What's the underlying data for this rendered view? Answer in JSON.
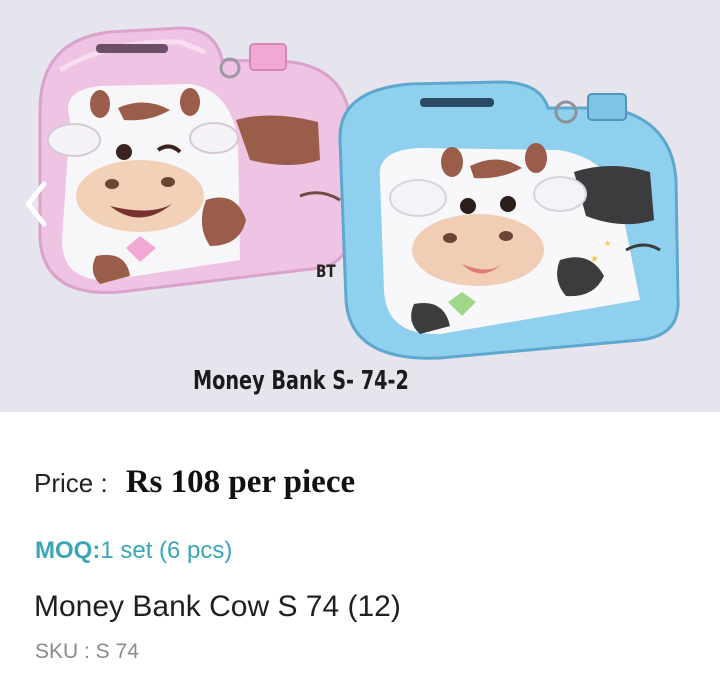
{
  "product_image": {
    "caption": "Money Bank S- 74-2",
    "badge": "BT",
    "background": "#e6e5ee",
    "left_item_color": "#efc3e3",
    "right_item_color": "#8fd0ef"
  },
  "navigation": {
    "prev_icon": "chevron-left-icon"
  },
  "price": {
    "label": "Price :",
    "value": "Rs 108 per piece"
  },
  "moq": {
    "label": "MOQ:",
    "value": "1 set (6 pcs)",
    "color": "#3aa7b6"
  },
  "product": {
    "title": "Money Bank Cow S 74 (12)",
    "sku": "SKU : S 74"
  }
}
